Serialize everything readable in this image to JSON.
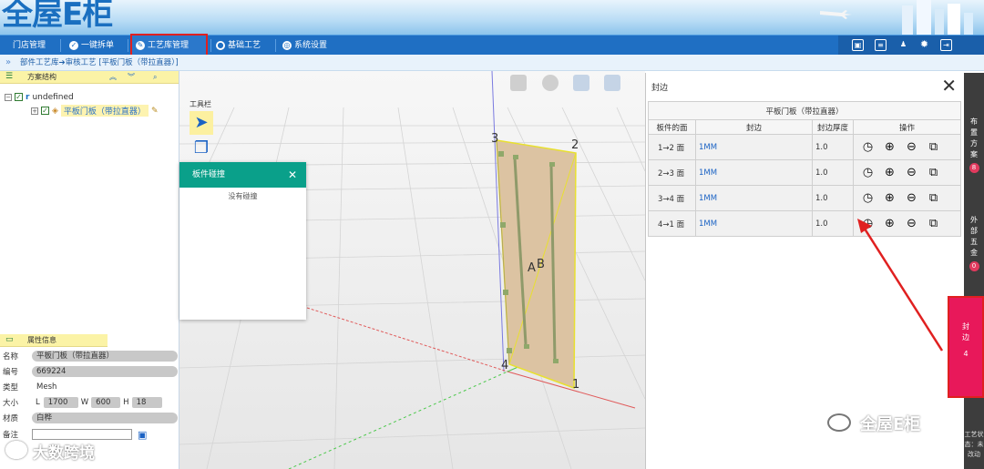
{
  "header": {
    "logo": "全屋E柜"
  },
  "nav": {
    "items": [
      {
        "label": "门店管理"
      },
      {
        "label": "一键拆单"
      },
      {
        "label": "工艺库管理"
      },
      {
        "label": "基础工艺"
      },
      {
        "label": "系统设置"
      }
    ]
  },
  "breadcrumb": {
    "text": "部件工艺库➔审核工艺 [平板门板（带拉直器）]"
  },
  "left_panel": {
    "scheme_title": "方案结构",
    "tree_root": "undefined",
    "tree_child": "平板门板（带拉直器）",
    "prop_title": "属性信息",
    "props": {
      "name_label": "名称",
      "name_value": "平板门板（带拉直器）",
      "code_label": "编号",
      "code_value": "669224",
      "type_label": "类型",
      "type_value": "Mesh",
      "size_label": "大小",
      "l_label": "L",
      "l_value": "1700",
      "w_label": "W",
      "w_value": "600",
      "h_label": "H",
      "h_value": "18",
      "material_label": "材质",
      "material_value": "白桦",
      "remark_label": "备注",
      "remark_value": ""
    }
  },
  "toolbar": {
    "label": "工具栏"
  },
  "collision": {
    "title": "板件碰撞",
    "body": "没有碰撞"
  },
  "viewport": {
    "corner_labels": [
      "3",
      "2",
      "4",
      "1"
    ],
    "center_labels": [
      "A",
      "B"
    ]
  },
  "edge_panel": {
    "title": "封边",
    "caption": "平板门板（带拉直器）",
    "columns": [
      "板件的面",
      "封边",
      "封边厚度",
      "操作"
    ],
    "rows": [
      {
        "face": "1→2 面",
        "edge": "1MM",
        "thickness": "1.0"
      },
      {
        "face": "2→3 面",
        "edge": "1MM",
        "thickness": "1.0"
      },
      {
        "face": "3→4 面",
        "edge": "1MM",
        "thickness": "1.0"
      },
      {
        "face": "4→1 面",
        "edge": "1MM",
        "thickness": "1.0"
      }
    ]
  },
  "right_tabs": {
    "layout": {
      "label": "布置方案",
      "count": "8"
    },
    "hardware": {
      "label": "外部五金",
      "count": "0"
    },
    "edge": {
      "label": "封边",
      "count": "4"
    },
    "status": "工艺状态：未改动"
  },
  "watermarks": {
    "left": "大数跨境",
    "right": "全屋E柜"
  },
  "colors": {
    "nav": "#1f6fc3",
    "accent_teal": "#0aa08a",
    "active_tab": "#e8185a",
    "highlight": "#e02020"
  }
}
